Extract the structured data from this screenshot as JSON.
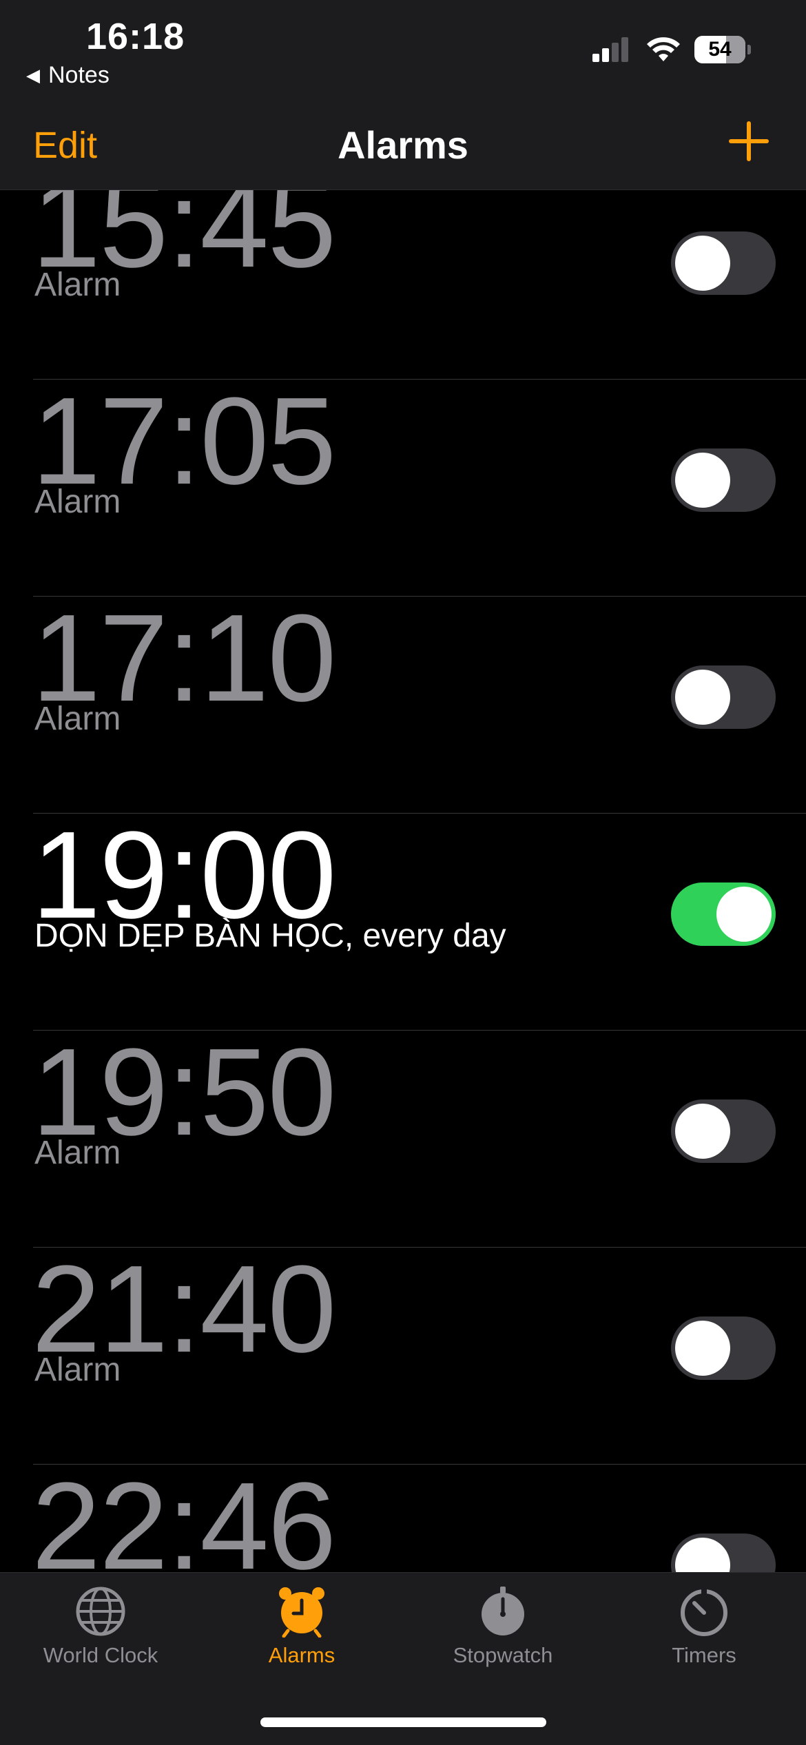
{
  "status_bar": {
    "time": "16:18",
    "back_label": "Notes",
    "battery": "54"
  },
  "nav": {
    "edit_label": "Edit",
    "title": "Alarms"
  },
  "alarms": [
    {
      "time": "15:45",
      "label": "Alarm",
      "enabled": false
    },
    {
      "time": "17:05",
      "label": "Alarm",
      "enabled": false
    },
    {
      "time": "17:10",
      "label": "Alarm",
      "enabled": false
    },
    {
      "time": "19:00",
      "label": "DỌN DẸP BÀN HỌC, every day",
      "enabled": true
    },
    {
      "time": "19:50",
      "label": "Alarm",
      "enabled": false
    },
    {
      "time": "21:40",
      "label": "Alarm",
      "enabled": false
    },
    {
      "time": "22:46",
      "label": "",
      "enabled": false
    }
  ],
  "tabs": [
    {
      "label": "World Clock",
      "icon": "globe-icon",
      "active": false
    },
    {
      "label": "Alarms",
      "icon": "alarm-clock-icon",
      "active": true
    },
    {
      "label": "Stopwatch",
      "icon": "stopwatch-icon",
      "active": false
    },
    {
      "label": "Timers",
      "icon": "timer-icon",
      "active": false
    }
  ],
  "colors": {
    "accent": "#ff9f0a",
    "toggle_on": "#30d158",
    "inactive_text": "#8e8e93"
  }
}
